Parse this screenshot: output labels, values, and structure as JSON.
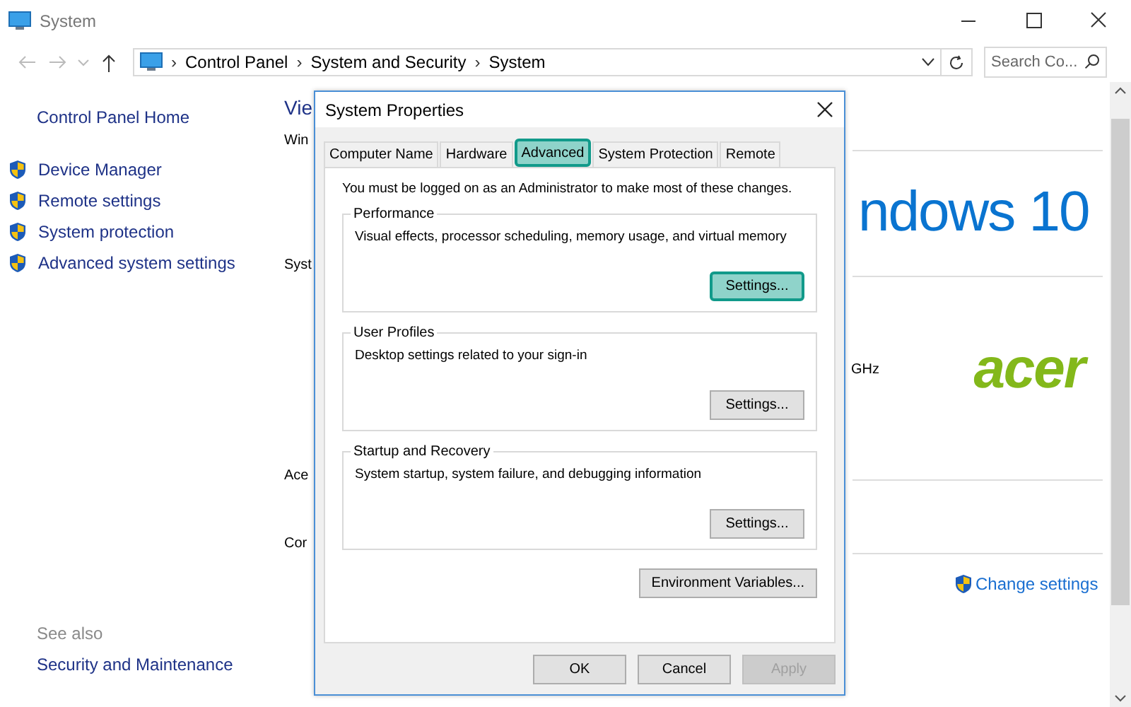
{
  "window": {
    "title": "System"
  },
  "address_bar": {
    "separator": "›",
    "breadcrumbs": [
      "Control Panel",
      "System and Security",
      "System"
    ]
  },
  "search": {
    "placeholder": "Search Co..."
  },
  "sidebar": {
    "home": "Control Panel Home",
    "items": [
      {
        "label": "Device Manager"
      },
      {
        "label": "Remote settings"
      },
      {
        "label": "System protection"
      },
      {
        "label": "Advanced system settings"
      }
    ],
    "see_also_title": "See also",
    "see_also": [
      "Security and Maintenance"
    ]
  },
  "main": {
    "heading": "Vie",
    "cut_labels": [
      "Win",
      "Syst",
      "Ace",
      "Cor"
    ],
    "edition_logo": "ndows 10",
    "processor_tail": "GHz",
    "brand_logo": "acer",
    "change_settings": "Change settings"
  },
  "dialog": {
    "title": "System Properties",
    "tabs": [
      {
        "label": "Computer Name",
        "selected": false,
        "highlighted": false
      },
      {
        "label": "Hardware",
        "selected": false,
        "highlighted": false
      },
      {
        "label": "Advanced",
        "selected": true,
        "highlighted": true
      },
      {
        "label": "System Protection",
        "selected": false,
        "highlighted": false
      },
      {
        "label": "Remote",
        "selected": false,
        "highlighted": false
      }
    ],
    "notice": "You must be logged on as an Administrator to make most of these changes.",
    "groups": [
      {
        "title": "Performance",
        "description": "Visual effects, processor scheduling, memory usage, and virtual memory",
        "button": "Settings...",
        "highlighted": true
      },
      {
        "title": "User Profiles",
        "description": "Desktop settings related to your sign-in",
        "button": "Settings...",
        "highlighted": false
      },
      {
        "title": "Startup and Recovery",
        "description": "System startup, system failure, and debugging information",
        "button": "Settings...",
        "highlighted": false
      }
    ],
    "env_button": "Environment Variables...",
    "buttons": [
      {
        "label": "OK",
        "disabled": false
      },
      {
        "label": "Cancel",
        "disabled": false
      },
      {
        "label": "Apply",
        "disabled": true
      }
    ]
  }
}
